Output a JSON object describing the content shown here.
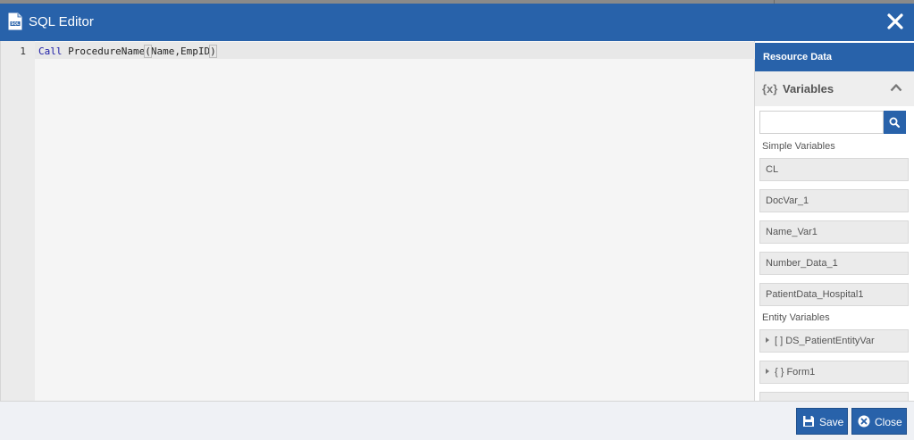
{
  "window": {
    "title": "SQL Editor",
    "icon": "sql-file-icon",
    "close_icon": "close-icon"
  },
  "editor": {
    "lines": [
      {
        "number": "1",
        "keyword": "Call",
        "name": " ProcedureName",
        "open": "(",
        "args": "Name,EmpID",
        "close": ")"
      }
    ]
  },
  "panel": {
    "header": "Resource Data",
    "variables_icon": "{x}",
    "variables_title": "Variables",
    "search": {
      "value": "",
      "placeholder": ""
    },
    "simple_label": "Simple Variables",
    "simple_variables": [
      "CL",
      "DocVar_1",
      "Name_Var1",
      "Number_Data_1",
      "PatientData_Hospital1"
    ],
    "entity_label": "Entity Variables",
    "entity_variables": [
      "[ ] DS_PatientEntityVar",
      "{ } Form1"
    ]
  },
  "footer": {
    "save_label": "Save",
    "close_label": "Close"
  },
  "colors": {
    "brand": "#2862aa",
    "keyword": "#1a1aa6"
  }
}
